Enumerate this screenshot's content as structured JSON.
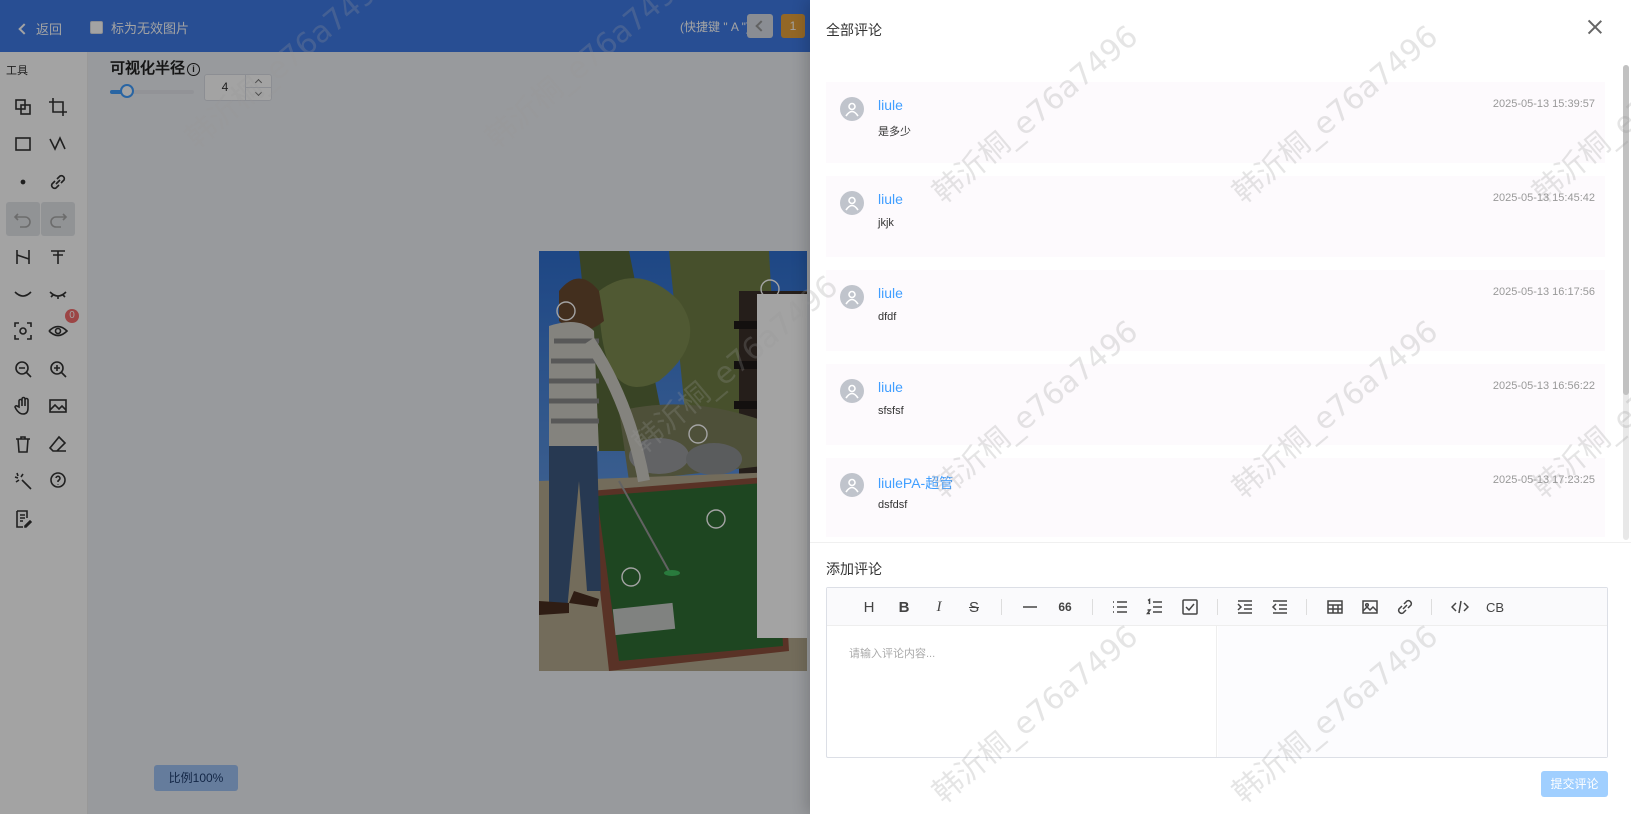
{
  "topbar": {
    "back_label": "返回",
    "invalid_label": "标为无效图片",
    "shortcut_label": "(快捷键 \" A \")",
    "page_number": "1"
  },
  "tools": {
    "title": "工具",
    "visible_count_badge": "0"
  },
  "canvas": {
    "radius_label": "可视化半径",
    "radius_info": "i",
    "radius_value": "4",
    "radius_fraction": 0.2,
    "scale_label": "比例100%"
  },
  "drawer": {
    "title": "全部评论",
    "comments": [
      {
        "user": "liule",
        "time": "2025-05-13 15:39:57",
        "text": "是多少"
      },
      {
        "user": "liule",
        "time": "2025-05-13 15:45:42",
        "text": "jkjk"
      },
      {
        "user": "liule",
        "time": "2025-05-13 16:17:56",
        "text": "dfdf"
      },
      {
        "user": "liule",
        "time": "2025-05-13 16:56:22",
        "text": "sfsfsf"
      },
      {
        "user": "liulePA-超管",
        "time": "2025-05-13 17:23:25",
        "text": "dsfdsf"
      }
    ],
    "add_title": "添加评论",
    "editor": {
      "heading_label": "H",
      "bold_label": "B",
      "italic_label": "I",
      "strike_label": "S",
      "quote_label": "66",
      "codeblock_label": "CB",
      "placeholder": "请输入评论内容..."
    },
    "submit_label": "提交评论"
  },
  "watermark": "韩沂桐_e76a7496",
  "colors": {
    "topbar": "#3f7be6",
    "accent": "#409eff",
    "badge": "#f56c6c",
    "page": "#e6a23c"
  }
}
